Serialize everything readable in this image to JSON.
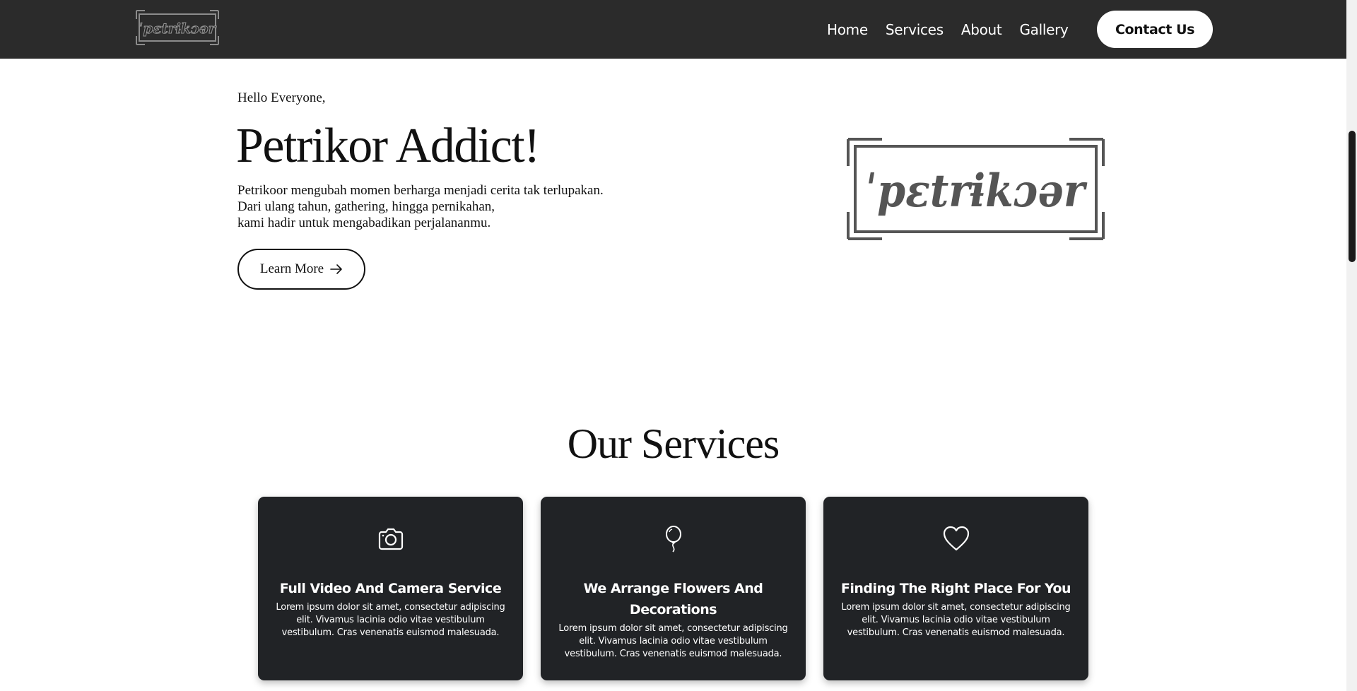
{
  "navbar": {
    "logo_text": "ˈpɛtrɨkɔər",
    "links": [
      "Home",
      "Services",
      "About",
      "Gallery"
    ],
    "contact_label": "Contact Us"
  },
  "hero": {
    "greeting": "Hello Everyone,",
    "title": "Petrikor Addict!",
    "description": [
      "Petrikoor mengubah momen berharga menjadi cerita tak terlupakan.",
      "Dari ulang tahun, gathering, hingga pernikahan,",
      "kami hadir untuk mengabadikan perjalananmu."
    ],
    "button_label": "Learn More",
    "button_icon": "arrow-right-icon",
    "logo_text": "ˈpɛtrɨkɔər"
  },
  "services": {
    "title": "Our Services",
    "cards": [
      {
        "icon": "camera-icon",
        "title": "Full Video And Camera Service",
        "text": "Lorem ipsum dolor sit amet, consectetur adipiscing elit. Vivamus lacinia odio vitae vestibulum vestibulum. Cras venenatis euismod malesuada."
      },
      {
        "icon": "balloon-icon",
        "title": "We Arrange Flowers And Decorations",
        "text": "Lorem ipsum dolor sit amet, consectetur adipiscing elit. Vivamus lacinia odio vitae vestibulum vestibulum. Cras venenatis euismod malesuada."
      },
      {
        "icon": "heart-icon",
        "title": "Finding The Right Place For You",
        "text": "Lorem ipsum dolor sit amet, consectetur adipiscing elit. Vivamus lacinia odio vitae vestibulum vestibulum. Cras venenatis euismod malesuada."
      }
    ]
  },
  "colors": {
    "navbar_bg": "#2b2b2b",
    "card_bg": "#212326",
    "logo_gray": "#555555"
  }
}
